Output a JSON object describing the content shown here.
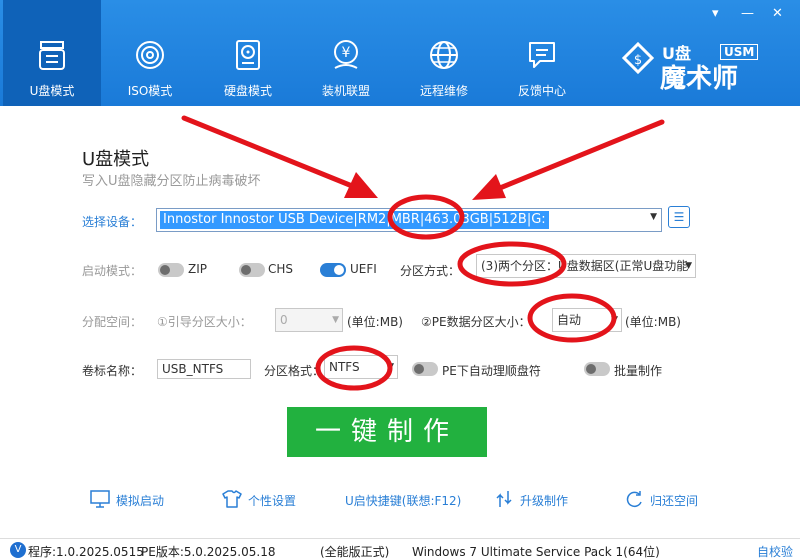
{
  "window": {
    "minimize_glyph": "▾",
    "min_glyph": "—",
    "close_glyph": "✕"
  },
  "nav": {
    "items": [
      {
        "label": "U盘模式",
        "icon": "usb-drive-icon"
      },
      {
        "label": "ISO模式",
        "icon": "disc-icon"
      },
      {
        "label": "硬盘模式",
        "icon": "hard-disk-icon"
      },
      {
        "label": "装机联盟",
        "icon": "yen-icon"
      },
      {
        "label": "远程维修",
        "icon": "globe-icon"
      },
      {
        "label": "反馈中心",
        "icon": "chat-icon"
      }
    ]
  },
  "logo": {
    "small": "U盘",
    "badge": "USM",
    "main": "魔术师"
  },
  "main": {
    "title": "U盘模式",
    "subtitle": "写入U盘隐藏分区防止病毒破坏",
    "device": {
      "label": "选择设备：",
      "value": "Innostor Innostor USB Device|RM2|MBR|463.03GB|512B|G:"
    },
    "boot": {
      "label": "启动模式：",
      "options": [
        {
          "label": "ZIP",
          "on": false
        },
        {
          "label": "CHS",
          "on": false
        },
        {
          "label": "UEFI",
          "on": true
        }
      ]
    },
    "partition_method": {
      "label": "分区方式：",
      "value": "(3)两个分区：U盘数据区(正常U盘功能"
    },
    "alloc": {
      "label": "分配空间：",
      "boot_size_label": "①引导分区大小：",
      "boot_size_value": "0",
      "unit1": "(单位:MB)",
      "pe_size_label": "②PE数据分区大小：",
      "pe_size_value": "自动",
      "unit2": "(单位:MB)"
    },
    "volume": {
      "label": "卷标名称：",
      "value": "USB_NTFS"
    },
    "format": {
      "label": "分区格式：",
      "value": "NTFS"
    },
    "pe_auto_label": "PE下自动理顺盘符",
    "batch_label": "批量制作",
    "go_button": "一键制作"
  },
  "tools": [
    {
      "label": "模拟启动",
      "icon": "monitor-icon"
    },
    {
      "label": "个性设置",
      "icon": "shirt-icon"
    },
    {
      "label": "U启快捷键(联想:F12)",
      "icon": ""
    },
    {
      "label": "升级制作",
      "icon": "upgrade-icon"
    },
    {
      "label": "归还空间",
      "icon": "restore-icon"
    }
  ],
  "status": {
    "version_badge": "V",
    "program": "程序:1.0.2025.0515",
    "pe": "PE版本:5.0.2025.05.18",
    "edition": "(全能版正式)",
    "os": "Windows 7 Ultimate Service Pack 1(64位)",
    "verify": "自校验"
  },
  "colors": {
    "header": "#1a7ad8",
    "accent": "#2a7fd6",
    "go": "#22b13f",
    "annotation": "#e3141b"
  }
}
